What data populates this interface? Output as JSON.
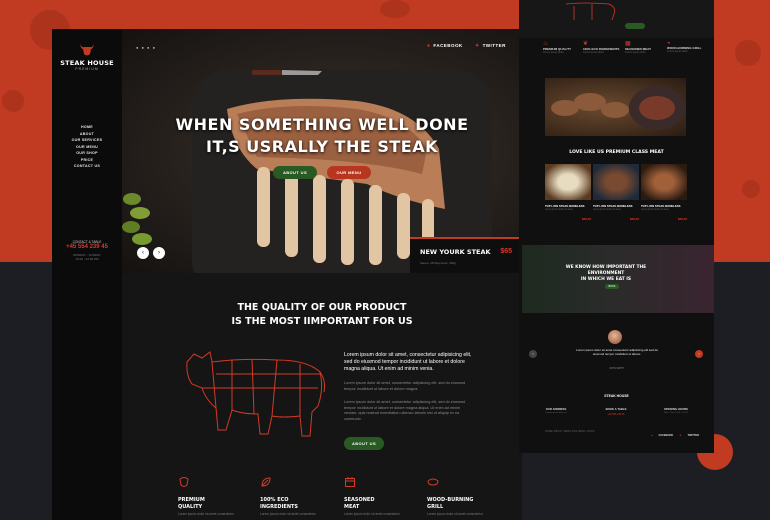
{
  "brand": {
    "name": "STEAK HOUSE",
    "tagline": "PREMIUM"
  },
  "nav": {
    "items": [
      "HOME",
      "ABOUT",
      "OUR SERVICES",
      "OUR MENU",
      "OUR SHOP",
      "PRICE",
      "CONTACT US"
    ]
  },
  "contact": {
    "label": "CONTACT & TABLE",
    "phone": "+45 554 239 45",
    "address_line1": "MONDAY - SUNDAY",
    "address_line2": "10:00 - 22:00 PM"
  },
  "hero": {
    "dots": "● ● ● ●",
    "social": {
      "facebook": "FACEBOOK",
      "twitter": "TWITTER"
    },
    "title_line1": "WHEN SOMETHING WELL DONE",
    "title_line2": "IT,S USRALLY THE STEAK",
    "about_button": "ABOUT US",
    "menu_button": "OUR MENU",
    "prev": "‹",
    "next": "›",
    "featured": {
      "name": "NEW YOURK STEAK",
      "price": "$65",
      "desc": "Sauce, 28 days beef, 300g"
    }
  },
  "quality": {
    "title_line1": "THE QUALITY OF OUR PRODUCT",
    "title_line2": "IS THE MOST IIMPORTANT FOR US",
    "lead": "Lorem ipsum dolor sit amet, consectetur adipisicing elit, sed do eiusmod tempor incididunt ut labore et dolore magna aliqua. Ut enim ad minim venia.",
    "para1": "Lorem ipsum dolor sit amet, consectetur adipisicing elit, sed do eiusmod tempor incididunt ut labore et dolore magna.",
    "para2": "Lorem ipsum dolor sit amet, consectetur adipisicing elit, sed do eiusmod tempor incididunt ut labore et dolore magna aliqua. Ut enim ad minim veniam, quis nostrud exercitation ullamco laboris nisi ut aliquip ex ea commodo.",
    "button": "ABOUT US"
  },
  "features": [
    {
      "icon": "steak-icon",
      "title1": "PREMIUM",
      "title2": "QUALITY",
      "desc": "Lorem ipsum dolor sit amet consectetur"
    },
    {
      "icon": "leaf-icon",
      "title1": "100% ECO",
      "title2": "INGREDIENTS",
      "desc": "Lorem ipsum dolor sit amet consectetur"
    },
    {
      "icon": "calendar-icon",
      "title1": "SEASONED",
      "title2": "MEAT",
      "desc": "Lorem ipsum dolor sit amet consectetur"
    },
    {
      "icon": "grill-icon",
      "title1": "WOOD-BURNING",
      "title2": "GRILL",
      "desc": "Lorem ipsum dolor sit amet consectetur"
    }
  ],
  "side": {
    "mini_features": [
      {
        "title": "PREMIUM QUALITY",
        "desc": "Lorem ipsum dolor"
      },
      {
        "title": "100% ECO INGREDIENTS",
        "desc": "Lorem ipsum dolor"
      },
      {
        "title": "SEASONED MEAT",
        "desc": "Lorem ipsum dolor"
      },
      {
        "title": "WOOD-BURNING GRILL",
        "desc": "Lorem ipsum dolor"
      }
    ],
    "heading": "LOVE LIKE US PREMIUM CLASS MEAT",
    "dishes": [
      {
        "name": "TOP LOIN STEAK BONELESS",
        "desc": "Lorem ipsum dolor sit amet",
        "price": "$28.00"
      },
      {
        "name": "TOP LOIN STEAK BONELESS",
        "desc": "Lorem ipsum dolor sit amet",
        "price": "$28.00"
      },
      {
        "name": "TOP LOIN STEAK BONELESS",
        "desc": "Lorem ipsum dolor sit amet",
        "price": "$28.00"
      }
    ],
    "banner_line1": "WE KNOW HOW IMPORTANT THE ENVIRONMENT",
    "banner_line2": "IN WHICH WE EAT IS",
    "banner_button": "BOOK",
    "quote": "Lorem ipsum dolor sit amet consectetur adipisicing elit sed do eiusmod tempor incididunt ut labore.",
    "quote_author": "JOHN SMITH",
    "footer_brand": "STEAK HOUSE",
    "footer_cols": [
      {
        "head": "OUR ADDRESS",
        "val": "",
        "text": "Lorem ipsum dolor sit"
      },
      {
        "head": "BOOK A TABLE",
        "val": "+45 554 239 45",
        "text": ""
      },
      {
        "head": "OPENING HOURS",
        "val": "",
        "text": "Mon - Sun 10:00 - 22:00"
      }
    ],
    "footer_links": "HOME    ABOUT    SERVICES    MENU    SHOP",
    "footer_social_fb": "FACEBOOK",
    "footer_social_tw": "TWITTER"
  },
  "colors": {
    "accent": "#c13a22",
    "accent_bright": "#e0362a",
    "green": "#2a5a23"
  }
}
